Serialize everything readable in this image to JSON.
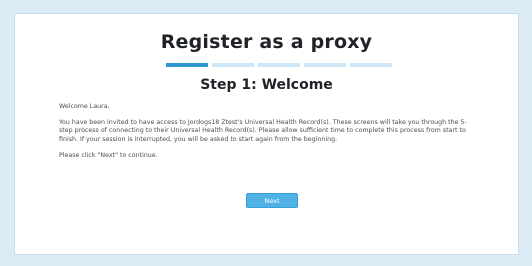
{
  "header": {
    "title": "Register as a proxy"
  },
  "progress": {
    "total_steps": 5,
    "current_step": 1
  },
  "step": {
    "title": "Step 1: Welcome"
  },
  "content": {
    "greeting": "Welcome Laura,",
    "paragraph": "You have been invited to have access to Jordogs18 Ztest's Universal Health Record(s). These screens will take you through the 5-step process of connecting to their Universal Health Record(s). Please allow sufficient time to complete this process from start to finish. If your session is interrupted, you will be asked to start again from the beginning.",
    "instruction": "Please click \"Next\" to continue."
  },
  "actions": {
    "next_label": "Next"
  },
  "colors": {
    "accent": "#2f96d1",
    "button": "#4fb3e8",
    "page_background": "#dcecf7"
  }
}
